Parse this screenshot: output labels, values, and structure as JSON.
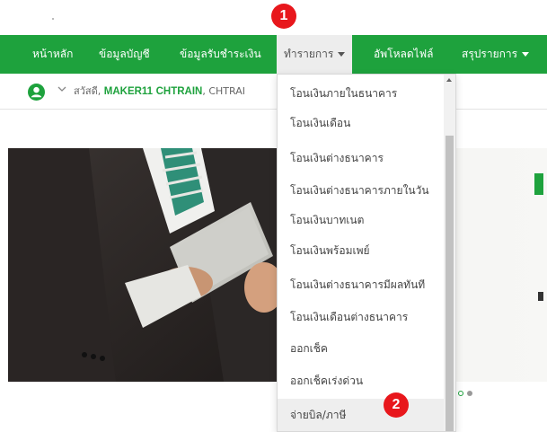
{
  "annotations": {
    "marker_1": "1",
    "marker_2": "2"
  },
  "nav": {
    "items": [
      {
        "label": "หน้าหลัก",
        "has_caret": false
      },
      {
        "label": "ข้อมูลบัญชี",
        "has_caret": false
      },
      {
        "label": "ข้อมูลรับชำระเงิน",
        "has_caret": false
      },
      {
        "label": "ทำรายการ",
        "has_caret": true,
        "active": true
      },
      {
        "label": "อัพโหลดไฟล์",
        "has_caret": false
      },
      {
        "label": "สรุปรายการ",
        "has_caret": true
      }
    ]
  },
  "user_bar": {
    "greeting": "สวัสดี,",
    "name_first": "MAKER11",
    "name_second": "CHTRAIN",
    "name_third": "CHTRAI"
  },
  "menu": {
    "items": [
      "โอนเงินภายในธนาคาร",
      "โอนเงินเดือน",
      "โอนเงินต่างธนาคาร",
      "โอนเงินต่างธนาคารภายในวัน",
      "โอนเงินบาทเนต",
      "โอนเงินพร้อมเพย์",
      "โอนเงินต่างธนาคารมีผลทันที",
      "โอนเงินเดือนต่างธนาคาร",
      "ออกเช็ค",
      "ออกเช็คเร่งด่วน",
      "จ่ายบิล/ภาษี"
    ],
    "hovered_index": 10
  },
  "colors": {
    "brand_green": "#1ea23d",
    "marker_red": "#e8171c",
    "active_tab_bg": "#ededed"
  },
  "icons": [
    "user-circle-icon",
    "chevron-down-icon",
    "caret-down-icon",
    "scroll-up-arrow-icon"
  ]
}
